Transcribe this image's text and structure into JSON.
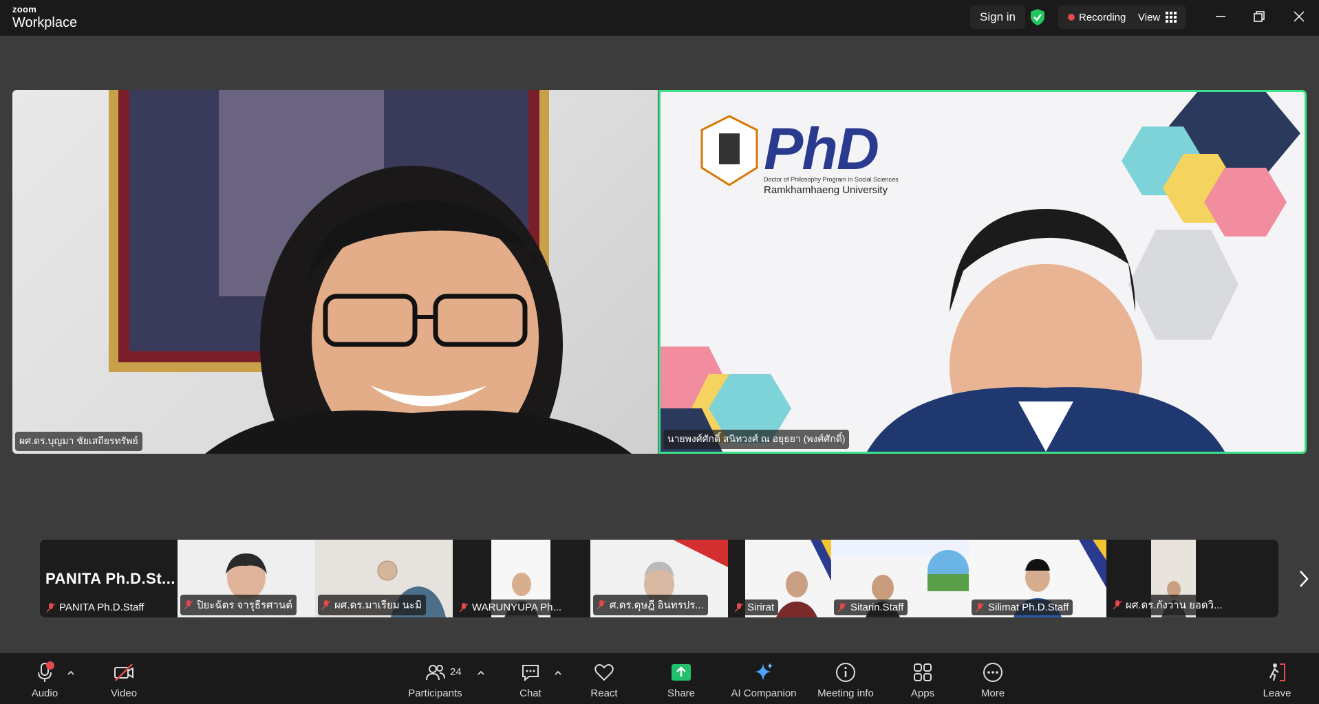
{
  "app": {
    "brand_top": "zoom",
    "brand_bottom": "Workplace"
  },
  "titlebar": {
    "sign_in": "Sign in",
    "recording": "Recording",
    "view": "View"
  },
  "main_videos": [
    {
      "name": "ผศ.ดร.บุญมา ชัยเสถียรทรัพย์"
    },
    {
      "name": "นายพงศ์ศักดิ์ สนิทวงศ์ ณ อยุธยา (พงศ์ศักดิ์)"
    }
  ],
  "slide": {
    "logo_text": "PhD",
    "program": "Doctor of Philosophy Program in Social Sciences",
    "university": "Ramkhamhaeng University"
  },
  "strip": {
    "tiles": [
      {
        "name": "PANITA Ph.D.Staff",
        "big": "PANITA  Ph.D.St..."
      },
      {
        "name": "ปิยะฉัตร จารุธีรศานต์"
      },
      {
        "name": "ผศ.ดร.มาเรียม นะมิ"
      },
      {
        "name": "WARUNYUPA Ph..."
      },
      {
        "name": "ศ.ดร.ดุษฎี อินทรปร..."
      },
      {
        "name": "Sirirat"
      },
      {
        "name": "Sitarin.Staff"
      },
      {
        "name": "Silimat Ph.D.Staff"
      },
      {
        "name": "ผศ.ดร.กังวาน ยอดวิ..."
      }
    ]
  },
  "toolbar": {
    "audio": "Audio",
    "video": "Video",
    "participants": "Participants",
    "participants_count": "24",
    "chat": "Chat",
    "react": "React",
    "share": "Share",
    "ai_companion": "AI Companion",
    "meeting_info": "Meeting info",
    "apps": "Apps",
    "more": "More",
    "leave": "Leave"
  },
  "colors": {
    "active_speaker": "#3ee08a",
    "share_green": "#21c06a",
    "recording_red": "#e5484d"
  }
}
